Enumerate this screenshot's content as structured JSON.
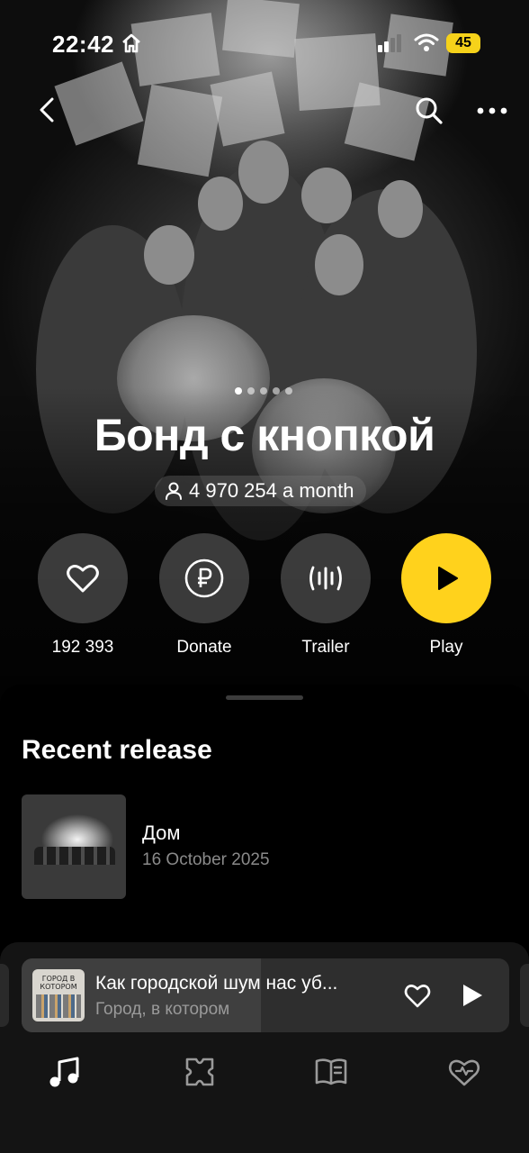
{
  "status_bar": {
    "time": "22:42",
    "battery": "45",
    "icons": [
      "home-icon",
      "signal-icon",
      "wifi-icon",
      "battery-icon"
    ]
  },
  "nav": {
    "icons": [
      "back-icon",
      "search-icon",
      "more-icon"
    ]
  },
  "artist": {
    "name": "Бонд с кнопкой",
    "listeners": "4 970 254 a month",
    "carousel_pages": 5,
    "carousel_active": 1
  },
  "actions": [
    {
      "label": "192 393",
      "icon": "heart-icon"
    },
    {
      "label": "Donate",
      "icon": "ruble-icon"
    },
    {
      "label": "Trailer",
      "icon": "waveform-icon"
    },
    {
      "label": "Play",
      "icon": "play-icon"
    }
  ],
  "recent_release": {
    "section_title": "Recent release",
    "title": "Дом",
    "date": "16 October 2025"
  },
  "player": {
    "cover_text": "ГОРОД В КОТОРОМ",
    "track_title": "Как городской шум нас уб...",
    "artist": "Город, в котором",
    "progress": 0.49,
    "icons": [
      "heart-icon",
      "play-icon"
    ]
  },
  "tab_bar": {
    "icons": [
      "music-note-icon",
      "collection-icon",
      "book-icon",
      "heart-wave-icon"
    ],
    "active": 0
  },
  "colors": {
    "accent": "#ffd21c",
    "background": "#000000",
    "secondary_text": "#8a8a8a"
  }
}
